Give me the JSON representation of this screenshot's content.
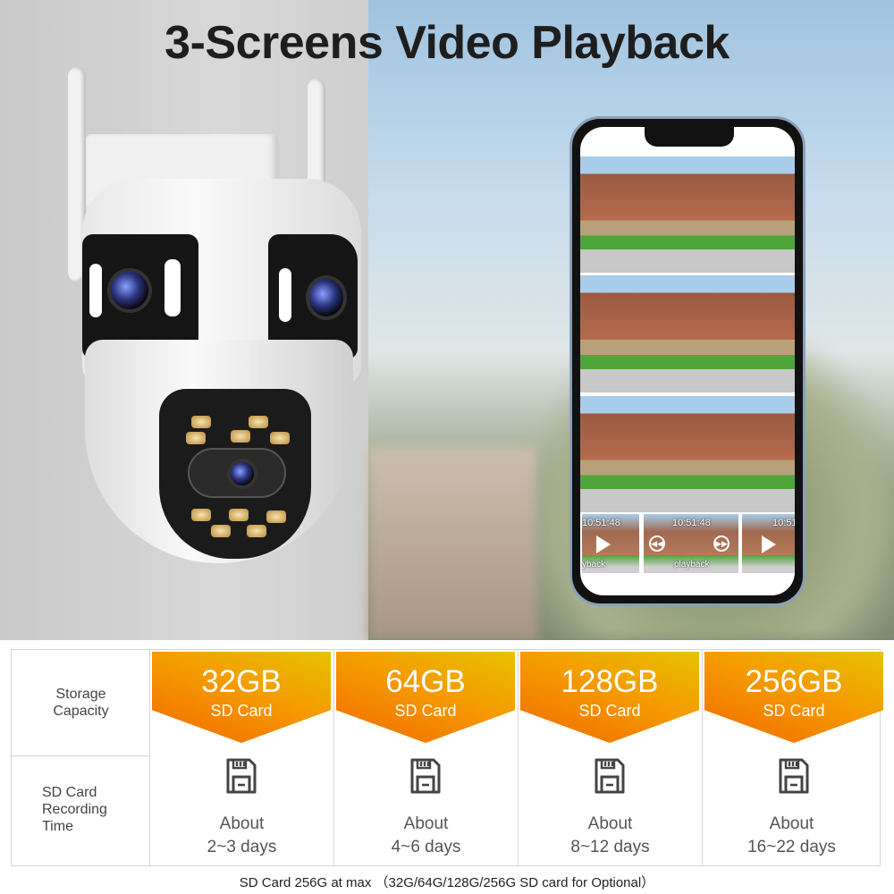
{
  "title": "3-Screens Video Playback",
  "phone": {
    "thumbnails": [
      {
        "timestamp": "10:51:48",
        "label": "yback"
      },
      {
        "timestamp": "10:51:48",
        "label": "playback"
      },
      {
        "timestamp": "10:51",
        "label": ""
      }
    ]
  },
  "table": {
    "row_labels": [
      "Storage Capacity",
      "SD Card Recording Time"
    ],
    "columns": [
      {
        "capacity": "32GB",
        "type": "SD Card",
        "about": "About",
        "time": "2~3 days"
      },
      {
        "capacity": "64GB",
        "type": "SD Card",
        "about": "About",
        "time": "4~6 days"
      },
      {
        "capacity": "128GB",
        "type": "SD Card",
        "about": "About",
        "time": "8~12 days"
      },
      {
        "capacity": "256GB",
        "type": "SD Card",
        "about": "About",
        "time": "16~22 days"
      }
    ],
    "icon": "sd-card-icon",
    "accent_colors": [
      "#f26a00",
      "#e7c200"
    ]
  },
  "footnote": "SD Card 256G at max （32G/64G/128G/256G SD card for Optional）"
}
